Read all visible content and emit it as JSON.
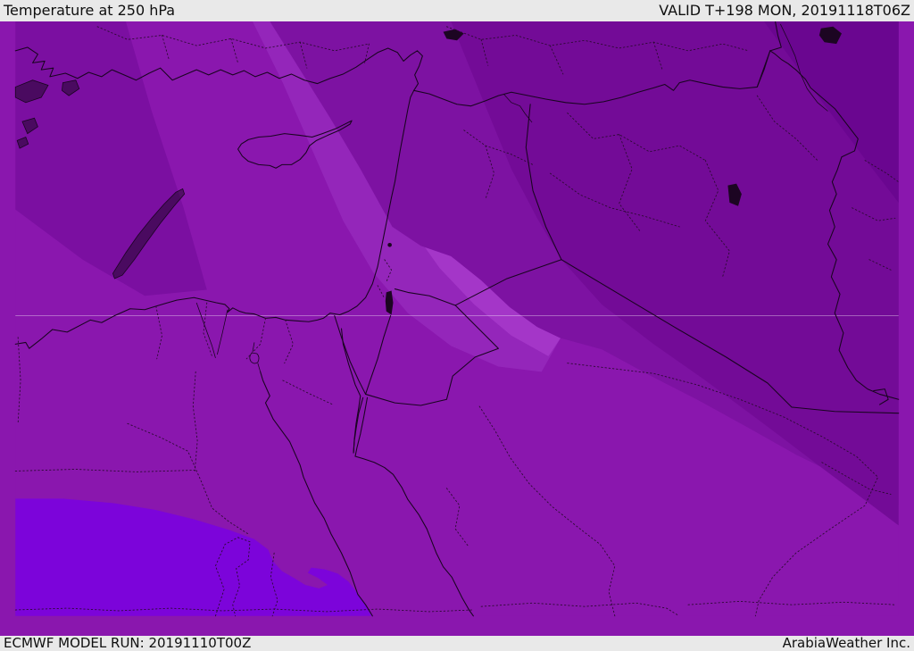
{
  "header": {
    "title": "Temperature at 250 hPa",
    "valid": "VALID T+198 MON, 20191118T06Z"
  },
  "footer": {
    "model_run": "ECMWF MODEL RUN: 20191110T00Z",
    "brand": "ArabiaWeather Inc."
  },
  "map": {
    "variable": "Temperature",
    "level": "250 hPa",
    "colors": {
      "base": "#8a17ae",
      "band_light_outer": "#9426ba",
      "band_light_inner": "#a436c8",
      "band_dark_1": "#7d12a2",
      "band_dark_2": "#730b97",
      "band_dark_3": "#6a0690",
      "northwest_pocket": "#7b0fa1",
      "southwest_bright": "#7c04da",
      "bar_background": "#e9e9e9",
      "bar_text": "#0f0f0f"
    }
  }
}
